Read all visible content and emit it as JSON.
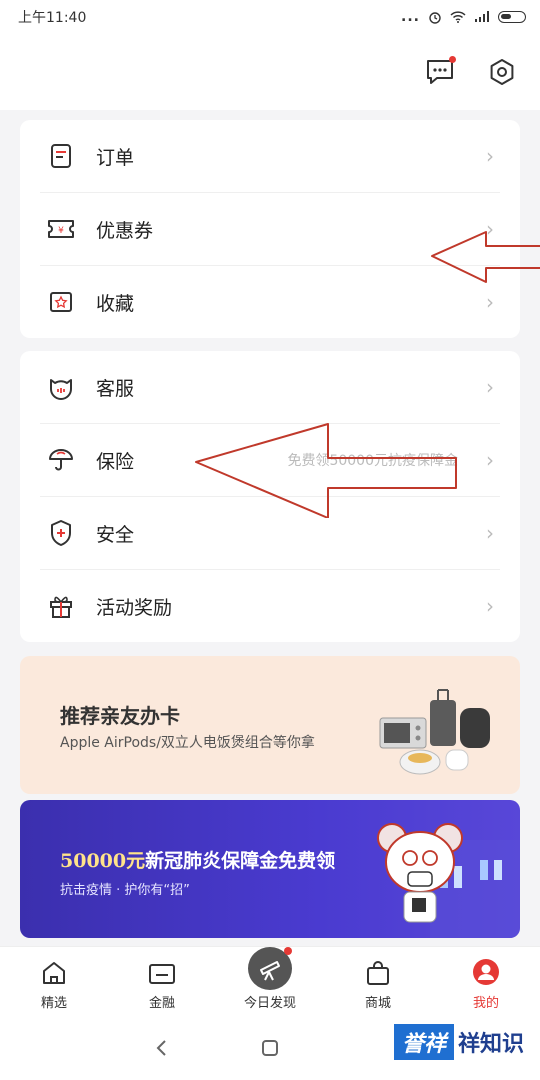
{
  "status_bar": {
    "time": "上午11:40",
    "signal_dots": "..."
  },
  "header": {
    "message_icon": "chat-bubble-icon",
    "settings_icon": "hexagon-gear-icon"
  },
  "group1": {
    "items": [
      {
        "label": "订单",
        "icon": "order-icon"
      },
      {
        "label": "优惠券",
        "icon": "coupon-icon"
      },
      {
        "label": "收藏",
        "icon": "favorite-icon"
      }
    ]
  },
  "group2": {
    "items": [
      {
        "label": "客服",
        "icon": "customer-service-icon"
      },
      {
        "label": "保险",
        "icon": "umbrella-icon",
        "hint": "免费领50000元抗疫保障金"
      },
      {
        "label": "安全",
        "icon": "shield-icon"
      },
      {
        "label": "活动奖励",
        "icon": "gift-icon"
      }
    ]
  },
  "banner_referral": {
    "title": "推荐亲友办卡",
    "subtitle": "Apple AirPods/双立人电饭煲组合等你拿"
  },
  "banner_insurance": {
    "title_amount": "50000元",
    "title_rest": "新冠肺炎保障金免费领",
    "subtitle": "抗击疫情 · 护你有“招”"
  },
  "tabbar": {
    "tabs": [
      {
        "label": "精选",
        "icon": "home-icon"
      },
      {
        "label": "金融",
        "icon": "wallet-icon"
      },
      {
        "label": "今日发现",
        "icon": "telescope-icon"
      },
      {
        "label": "商城",
        "icon": "shopping-bag-icon"
      },
      {
        "label": "我的",
        "icon": "user-icon",
        "active": true
      }
    ]
  },
  "watermark": {
    "box": "誉祥",
    "text": "祥知识"
  },
  "colors": {
    "accent": "#e53935",
    "annotation": "#c0392b",
    "banner_blue": "#4a3bd0",
    "banner_peach": "#fbe9dc"
  }
}
